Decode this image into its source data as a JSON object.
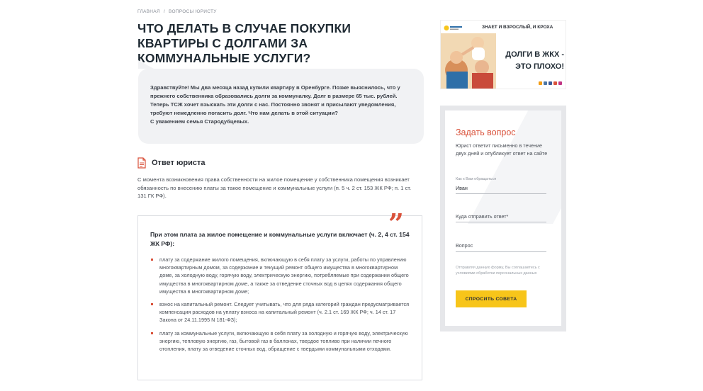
{
  "breadcrumb": {
    "home": "ГЛАВНАЯ",
    "sep": "/",
    "current": "ВОПРОСЫ ЮРИСТУ"
  },
  "title": "ЧТО ДЕЛАТЬ В СЛУЧАЕ ПОКУПКИ КВАРТИРЫ С ДОЛГАМИ ЗА КОММУНАЛЬНЫЕ УСЛУГИ?",
  "question": {
    "text": "Здравствуйте! Мы два месяца назад купили квартиру в Оренбурге. Позже выяснилось, что у прежнего собственника образовались долги за коммуналку. Долг в размере 65 тыс. рублей. Теперь ТСЖ хочет взыскать эти долги с нас. Постоянно звонят и присылают уведомления, требуют немедленно погасить долг. Что нам делать в этой ситуации?",
    "signature": "С уважением семья Стародубцевых."
  },
  "answer": {
    "title": "Ответ юриста",
    "text": "С момента возникновения права собственности на жилое помещение у собственника помещения возникает обязанность по внесению платы за такое помещение и коммунальные услуги (п. 5 ч. 2 ст. 153 ЖК РФ; п. 1 ст. 131 ГК РФ)."
  },
  "quote": {
    "mark": "”",
    "heading": "При этом плата за жилое помещение и коммунальные услуги включает (ч. 2, 4 ст. 154 ЖК РФ):",
    "items": [
      "плату за содержание жилого помещения, включающую в себя плату за услуги, работы по управлению многоквартирным домом, за содержание и текущий ремонт общего имущества в многоквартирном доме, за холодную воду, горячую воду, электрическую энергию, потребляемые при содержании общего имущества в многоквартирном доме, а также за отведение сточных вод в целях содержания общего имущества в многоквартирном доме;",
      "взнос на капитальный ремонт. Следует учитывать, что для ряда категорий граждан предусматривается компенсация расходов на уплату взноса на капитальный ремонт (ч. 2.1 ст. 169 ЖК РФ; ч. 14 ст. 17 Закона от 24.11.1995 N 181-ФЗ);",
      "плату за коммунальные услуги, включающую в себя плату за холодную и горячую воду, электрическую энергию, тепловую энергию, газ, бытовой газ в баллонах, твердое топливо при наличии печного отопления, плату за отведение сточных вод, обращение с твердыми коммунальными отходами."
    ]
  },
  "banner": {
    "top_text": "ЗНАЕТ И ВЗРОСЛЫЙ, И КРОХА",
    "main_line1": "ДОЛГИ В ЖКХ -",
    "main_line2": "ЭТО ПЛОХО!"
  },
  "form": {
    "title": "Задать вопрос",
    "description": "Юрист ответит письменно в течение двух дней и опубликует ответ на сайте",
    "name_label": "Как к Вам обращаться",
    "name_value": "Иван",
    "where_placeholder": "Куда отправить ответ*",
    "question_placeholder": "Вопрос",
    "consent": "Отправляя данную форму, Вы соглашаетесь с условиями обработки персональных данных",
    "submit": "СПРОСИТЬ СОВЕТА"
  },
  "colors": {
    "accent": "#d9523b",
    "button": "#f7c51a",
    "bubble": "#f1f2f4"
  }
}
